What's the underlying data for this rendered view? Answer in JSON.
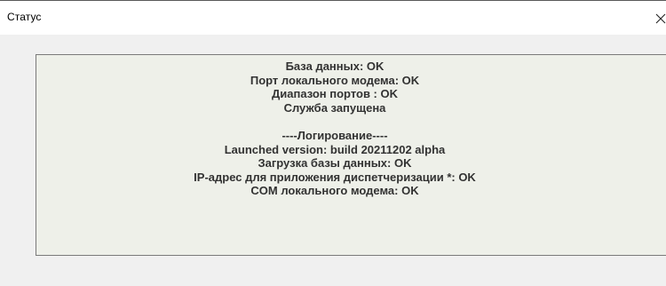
{
  "window": {
    "title": "Статус",
    "close_icon": "close-icon"
  },
  "status": {
    "lines": [
      "База данных: OK",
      "Порт локального модема: OK",
      "Диапазон портов : OK",
      "Служба запущена",
      "",
      "----Логирование----",
      "Launched version: build 20211202 alpha",
      "Загрузка базы данных: OK",
      "IP-адрес для приложения диспетчеризации *: OK",
      "COM локального модема: OK"
    ]
  },
  "colors": {
    "panel_background": "#eef0e9",
    "dialog_background": "#f0f0f0",
    "text": "#323232"
  }
}
